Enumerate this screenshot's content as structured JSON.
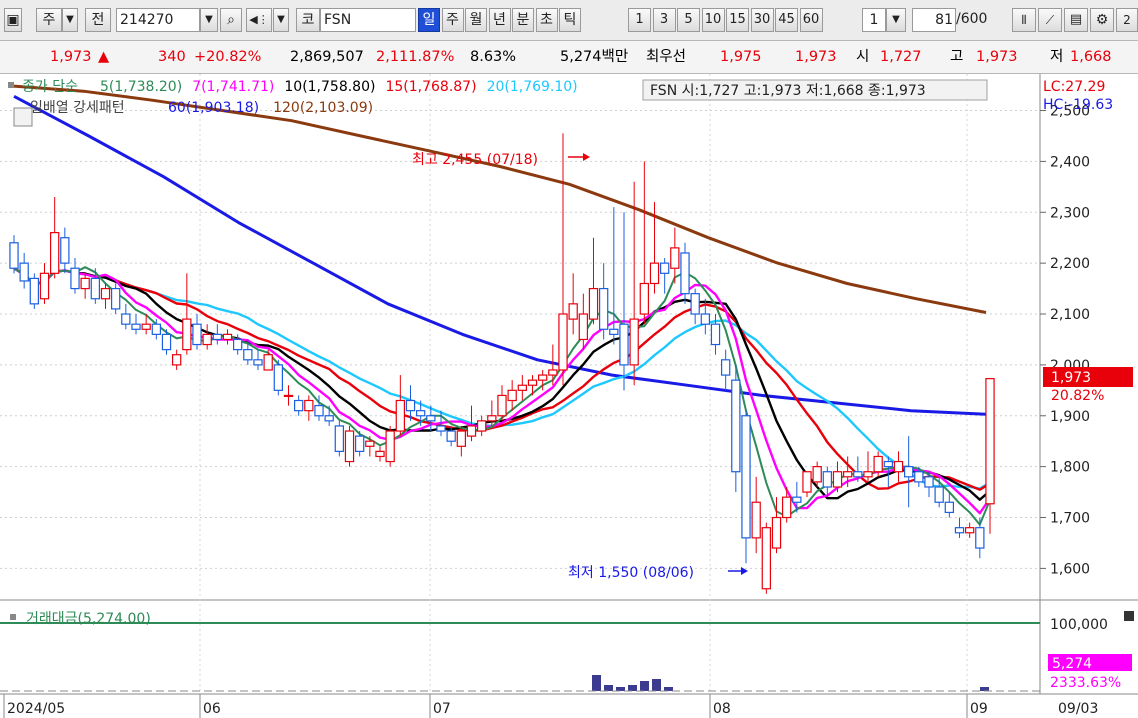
{
  "toolbar": {
    "period_label": "주",
    "prev_label": "전",
    "code": "214270",
    "market_label": "코",
    "symbol": "FSN",
    "tabs": [
      {
        "label": "일",
        "active": true
      },
      {
        "label": "주",
        "active": false
      },
      {
        "label": "월",
        "active": false
      },
      {
        "label": "년",
        "active": false
      },
      {
        "label": "분",
        "active": false
      },
      {
        "label": "초",
        "active": false
      },
      {
        "label": "틱",
        "active": false
      }
    ],
    "intervals": [
      "1",
      "3",
      "5",
      "10",
      "15",
      "30",
      "45",
      "60"
    ],
    "interval_value": "1",
    "count": "81",
    "count_total": "/600"
  },
  "info": {
    "price": "1,973",
    "arrow": "▲",
    "change": "340",
    "change_pct": "+20.82%",
    "volume": "2,869,507",
    "volume_ratio": "2,111.87%",
    "turnover": "8.63%",
    "amount": "5,274백만",
    "ask_label": "최우선",
    "ask": "1,975",
    "bid": "1,973",
    "open_label": "시",
    "open": "1,727",
    "high_label": "고",
    "high": "1,973",
    "low_label": "저",
    "low": "1,668"
  },
  "legend": {
    "price_label": "종가 단순",
    "ma": [
      {
        "text": "5(1,738.20)",
        "color": "#2e8b57"
      },
      {
        "text": "7(1,741.71)",
        "color": "#ff00ff"
      },
      {
        "text": "10(1,758.80)",
        "color": "#000000"
      },
      {
        "text": "15(1,768.87)",
        "color": "#e8000b"
      },
      {
        "text": "20(1,769.10)",
        "color": "#1ec8ff"
      }
    ],
    "ohlc_box": "FSN 시:1,727 고:1,973 저:1,668 종:1,973",
    "line2_label": "일배열 강세패턴",
    "ma2": [
      {
        "text": "60(1,903.18)",
        "color": "#1a1ae6"
      },
      {
        "text": "120(2,103.09)",
        "color": "#8b3a0f"
      }
    ],
    "lc": "LC:27.29",
    "hc": "HC:-19.63"
  },
  "annotations": {
    "high": "최고 2,455 (07/18)",
    "low": "최저 1,550 (08/06)"
  },
  "price_axis": {
    "ticks": [
      "2,500",
      "2,400",
      "2,300",
      "2,200",
      "2,100",
      "2,000",
      "1,900",
      "1,800",
      "1,700",
      "1,600"
    ],
    "current": "1,973",
    "current_pct": "20.82%"
  },
  "volume_panel": {
    "label": "거래대금(5,274.00)",
    "axis_top": "100,000",
    "current": "5,274",
    "current_pct": "2333.63%"
  },
  "date_axis": {
    "labels": [
      "2024/05",
      "06",
      "07",
      "08",
      "09",
      "09/03"
    ]
  },
  "colors": {
    "up": "#e8000b",
    "down": "#1a5fe0",
    "ma5": "#2e8b57",
    "ma7": "#ff00ff",
    "ma10": "#000000",
    "ma15": "#e8000b",
    "ma20": "#1ec8ff",
    "ma60": "#1a1ae6",
    "ma120": "#8b3a0f",
    "volume_ref": "#2e8b57",
    "current_bg": "#e8000b",
    "volume_current_bg": "#ff00ff"
  },
  "chart_data": {
    "type": "candlestick",
    "title": "FSN",
    "y_range": [
      1530,
      2560
    ],
    "x_labels": [
      "2024/05",
      "06",
      "07",
      "08",
      "09"
    ],
    "candles": [
      {
        "o": 2240,
        "h": 2255,
        "l": 2180,
        "c": 2190
      },
      {
        "o": 2200,
        "h": 2220,
        "l": 2150,
        "c": 2165
      },
      {
        "o": 2170,
        "h": 2180,
        "l": 2110,
        "c": 2120
      },
      {
        "o": 2130,
        "h": 2200,
        "l": 2120,
        "c": 2180
      },
      {
        "o": 2180,
        "h": 2330,
        "l": 2170,
        "c": 2260
      },
      {
        "o": 2250,
        "h": 2270,
        "l": 2180,
        "c": 2200
      },
      {
        "o": 2190,
        "h": 2210,
        "l": 2140,
        "c": 2150
      },
      {
        "o": 2150,
        "h": 2180,
        "l": 2130,
        "c": 2170
      },
      {
        "o": 2170,
        "h": 2190,
        "l": 2120,
        "c": 2130
      },
      {
        "o": 2130,
        "h": 2160,
        "l": 2110,
        "c": 2150
      },
      {
        "o": 2150,
        "h": 2160,
        "l": 2100,
        "c": 2110
      },
      {
        "o": 2100,
        "h": 2120,
        "l": 2070,
        "c": 2080
      },
      {
        "o": 2080,
        "h": 2100,
        "l": 2060,
        "c": 2070
      },
      {
        "o": 2070,
        "h": 2100,
        "l": 2060,
        "c": 2080
      },
      {
        "o": 2080,
        "h": 2090,
        "l": 2050,
        "c": 2060
      },
      {
        "o": 2060,
        "h": 2070,
        "l": 2020,
        "c": 2030
      },
      {
        "o": 2000,
        "h": 2030,
        "l": 1990,
        "c": 2020
      },
      {
        "o": 2030,
        "h": 2180,
        "l": 2020,
        "c": 2090
      },
      {
        "o": 2080,
        "h": 2100,
        "l": 2030,
        "c": 2040
      },
      {
        "o": 2040,
        "h": 2080,
        "l": 2030,
        "c": 2060
      },
      {
        "o": 2060,
        "h": 2080,
        "l": 2040,
        "c": 2050
      },
      {
        "o": 2050,
        "h": 2070,
        "l": 2040,
        "c": 2060
      },
      {
        "o": 2050,
        "h": 2060,
        "l": 2020,
        "c": 2030
      },
      {
        "o": 2030,
        "h": 2050,
        "l": 2000,
        "c": 2010
      },
      {
        "o": 2010,
        "h": 2030,
        "l": 1990,
        "c": 2000
      },
      {
        "o": 1990,
        "h": 2030,
        "l": 1990,
        "c": 2020
      },
      {
        "o": 2000,
        "h": 2010,
        "l": 1940,
        "c": 1950
      },
      {
        "o": 1940,
        "h": 1960,
        "l": 1920,
        "c": 1940
      },
      {
        "o": 1930,
        "h": 1940,
        "l": 1900,
        "c": 1910
      },
      {
        "o": 1910,
        "h": 1940,
        "l": 1890,
        "c": 1930
      },
      {
        "o": 1920,
        "h": 1940,
        "l": 1890,
        "c": 1900
      },
      {
        "o": 1900,
        "h": 1920,
        "l": 1880,
        "c": 1890
      },
      {
        "o": 1880,
        "h": 1890,
        "l": 1820,
        "c": 1830
      },
      {
        "o": 1810,
        "h": 1880,
        "l": 1800,
        "c": 1870
      },
      {
        "o": 1860,
        "h": 1870,
        "l": 1820,
        "c": 1830
      },
      {
        "o": 1840,
        "h": 1860,
        "l": 1820,
        "c": 1850
      },
      {
        "o": 1820,
        "h": 1840,
        "l": 1810,
        "c": 1830
      },
      {
        "o": 1810,
        "h": 1880,
        "l": 1800,
        "c": 1870
      },
      {
        "o": 1870,
        "h": 1980,
        "l": 1860,
        "c": 1930
      },
      {
        "o": 1930,
        "h": 1960,
        "l": 1890,
        "c": 1910
      },
      {
        "o": 1910,
        "h": 1930,
        "l": 1880,
        "c": 1900
      },
      {
        "o": 1900,
        "h": 1920,
        "l": 1870,
        "c": 1890
      },
      {
        "o": 1880,
        "h": 1910,
        "l": 1860,
        "c": 1870
      },
      {
        "o": 1870,
        "h": 1880,
        "l": 1840,
        "c": 1850
      },
      {
        "o": 1840,
        "h": 1880,
        "l": 1820,
        "c": 1870
      },
      {
        "o": 1860,
        "h": 1920,
        "l": 1850,
        "c": 1880
      },
      {
        "o": 1870,
        "h": 1900,
        "l": 1860,
        "c": 1890
      },
      {
        "o": 1890,
        "h": 1930,
        "l": 1880,
        "c": 1900
      },
      {
        "o": 1900,
        "h": 1960,
        "l": 1890,
        "c": 1940
      },
      {
        "o": 1930,
        "h": 1970,
        "l": 1910,
        "c": 1950
      },
      {
        "o": 1950,
        "h": 1980,
        "l": 1930,
        "c": 1960
      },
      {
        "o": 1960,
        "h": 1980,
        "l": 1940,
        "c": 1970
      },
      {
        "o": 1970,
        "h": 1990,
        "l": 1950,
        "c": 1980
      },
      {
        "o": 1980,
        "h": 2040,
        "l": 1960,
        "c": 1990
      },
      {
        "o": 1990,
        "h": 2455,
        "l": 1960,
        "c": 2100
      },
      {
        "o": 2090,
        "h": 2180,
        "l": 2060,
        "c": 2120
      },
      {
        "o": 2050,
        "h": 2140,
        "l": 2030,
        "c": 2100
      },
      {
        "o": 2090,
        "h": 2250,
        "l": 2080,
        "c": 2150
      },
      {
        "o": 2150,
        "h": 2200,
        "l": 2050,
        "c": 2070
      },
      {
        "o": 2070,
        "h": 2310,
        "l": 2040,
        "c": 2060
      },
      {
        "o": 2080,
        "h": 2300,
        "l": 1950,
        "c": 2000
      },
      {
        "o": 2000,
        "h": 2360,
        "l": 1960,
        "c": 2090
      },
      {
        "o": 2100,
        "h": 2400,
        "l": 2080,
        "c": 2160
      },
      {
        "o": 2160,
        "h": 2320,
        "l": 2140,
        "c": 2200
      },
      {
        "o": 2200,
        "h": 2210,
        "l": 2140,
        "c": 2180
      },
      {
        "o": 2190,
        "h": 2270,
        "l": 2160,
        "c": 2230
      },
      {
        "o": 2220,
        "h": 2240,
        "l": 2120,
        "c": 2140
      },
      {
        "o": 2140,
        "h": 2150,
        "l": 2080,
        "c": 2100
      },
      {
        "o": 2100,
        "h": 2130,
        "l": 2060,
        "c": 2080
      },
      {
        "o": 2080,
        "h": 2100,
        "l": 2020,
        "c": 2040
      },
      {
        "o": 2010,
        "h": 2030,
        "l": 1950,
        "c": 1980
      },
      {
        "o": 1970,
        "h": 2000,
        "l": 1750,
        "c": 1790
      },
      {
        "o": 1900,
        "h": 1910,
        "l": 1610,
        "c": 1660
      },
      {
        "o": 1660,
        "h": 1780,
        "l": 1630,
        "c": 1730
      },
      {
        "o": 1560,
        "h": 1690,
        "l": 1550,
        "c": 1680
      },
      {
        "o": 1640,
        "h": 1740,
        "l": 1630,
        "c": 1700
      },
      {
        "o": 1700,
        "h": 1760,
        "l": 1690,
        "c": 1740
      },
      {
        "o": 1740,
        "h": 1770,
        "l": 1710,
        "c": 1730
      },
      {
        "o": 1750,
        "h": 1790,
        "l": 1740,
        "c": 1790
      },
      {
        "o": 1770,
        "h": 1810,
        "l": 1760,
        "c": 1800
      },
      {
        "o": 1790,
        "h": 1800,
        "l": 1740,
        "c": 1760
      },
      {
        "o": 1760,
        "h": 1810,
        "l": 1750,
        "c": 1790
      },
      {
        "o": 1780,
        "h": 1820,
        "l": 1760,
        "c": 1790
      },
      {
        "o": 1790,
        "h": 1820,
        "l": 1770,
        "c": 1780
      },
      {
        "o": 1780,
        "h": 1830,
        "l": 1770,
        "c": 1790
      },
      {
        "o": 1790,
        "h": 1830,
        "l": 1780,
        "c": 1820
      },
      {
        "o": 1810,
        "h": 1820,
        "l": 1760,
        "c": 1800
      },
      {
        "o": 1790,
        "h": 1830,
        "l": 1770,
        "c": 1810
      },
      {
        "o": 1800,
        "h": 1860,
        "l": 1720,
        "c": 1780
      },
      {
        "o": 1790,
        "h": 1800,
        "l": 1760,
        "c": 1770
      },
      {
        "o": 1780,
        "h": 1790,
        "l": 1740,
        "c": 1760
      },
      {
        "o": 1760,
        "h": 1780,
        "l": 1720,
        "c": 1730
      },
      {
        "o": 1730,
        "h": 1750,
        "l": 1700,
        "c": 1710
      },
      {
        "o": 1680,
        "h": 1700,
        "l": 1660,
        "c": 1670
      },
      {
        "o": 1670,
        "h": 1690,
        "l": 1660,
        "c": 1680
      },
      {
        "o": 1680,
        "h": 1700,
        "l": 1620,
        "c": 1640
      },
      {
        "o": 1727,
        "h": 1973,
        "l": 1668,
        "c": 1973
      }
    ],
    "ma60": [
      2528,
      2450,
      2370,
      2280,
      2200,
      2120,
      2060,
      2010,
      1980,
      1960,
      1940,
      1925,
      1910,
      1903
    ],
    "ma120": [
      2548,
      2538,
      2520,
      2500,
      2480,
      2450,
      2420,
      2390,
      2355,
      2305,
      2250,
      2200,
      2160,
      2130,
      2103
    ],
    "volume_axis": "100,000",
    "volume_bars": [
      8,
      3,
      2,
      3,
      6,
      4,
      2,
      0,
      0,
      0,
      0,
      0,
      0,
      0,
      0,
      0,
      0,
      0,
      0,
      0,
      0,
      0,
      0,
      0,
      0,
      0,
      0,
      0,
      0,
      0,
      0,
      5274
    ]
  }
}
